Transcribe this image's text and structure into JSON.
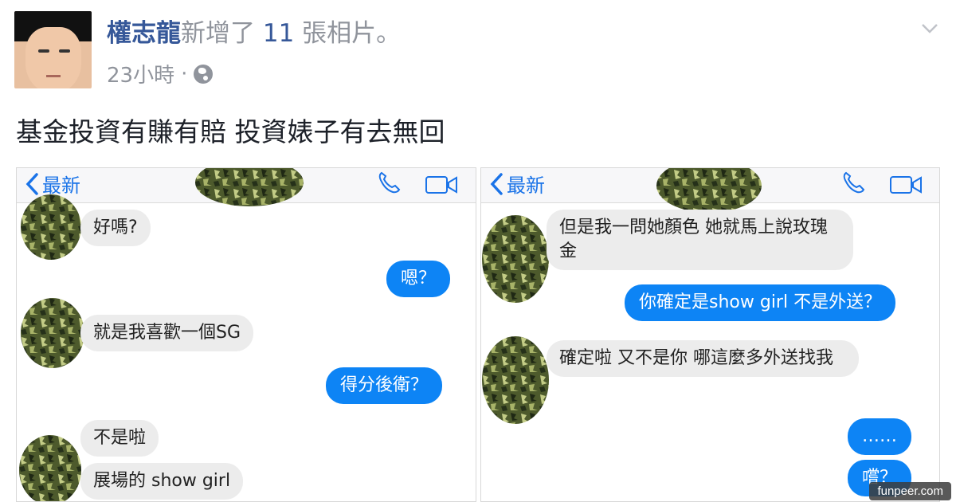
{
  "post": {
    "author": "權志龍",
    "action": "新增了",
    "count": "11",
    "action_suffix": "張相片。",
    "time": "23小時",
    "separator": "·",
    "caption": "基金投資有賺有賠 投資婊子有去無回"
  },
  "screens": {
    "left": {
      "back_label": "最新",
      "messages": {
        "m1": "好嗎?",
        "m2": "嗯？",
        "m3": "就是我喜歡一個SG",
        "m4": "得分後衛？",
        "m5": "不是啦",
        "m6": "展場的 show girl"
      }
    },
    "right": {
      "back_label": "最新",
      "messages": {
        "m1": "但是我一問她顏色 她就馬上說玫瑰金",
        "m2": "你確定是show girl 不是外送？",
        "m3": "確定啦 又不是你 哪這麼多外送找我",
        "m4": "……",
        "m5": "嚐？"
      }
    }
  },
  "watermark": "funpeer.com",
  "colors": {
    "link": "#365899",
    "meta": "#90949c",
    "ios_blue": "#1a73e8",
    "bubble_out": "#0d84f5",
    "bubble_in": "#ececec",
    "camo_dark": "#2e3a1e",
    "camo_light": "#b8c27a"
  },
  "icons": [
    "chevron-down-icon",
    "globe-icon",
    "back-chevron-icon",
    "phone-icon",
    "video-camera-icon"
  ]
}
